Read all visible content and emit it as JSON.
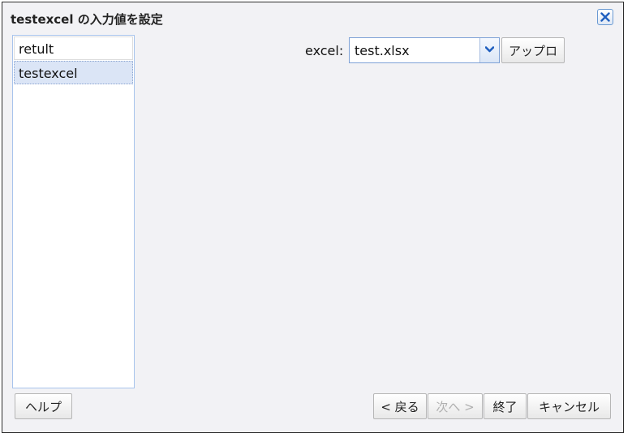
{
  "dialog": {
    "title": "testexcel の入力値を設定",
    "close_icon": "close-icon"
  },
  "list": {
    "items": [
      {
        "label": "retult",
        "selected": false
      },
      {
        "label": "testexcel",
        "selected": true
      }
    ]
  },
  "form": {
    "excel_label": "excel:",
    "excel_value": "test.xlsx",
    "upload_label": "アップロ"
  },
  "footer": {
    "help_label": "ヘルプ",
    "back_label": "< 戻る",
    "next_label": "次へ >",
    "finish_label": "終了",
    "cancel_label": "キャンセル"
  },
  "colors": {
    "accent": "#1f5fbf",
    "selection": "#dbe5f6",
    "panel_border": "#a8c4ec"
  }
}
